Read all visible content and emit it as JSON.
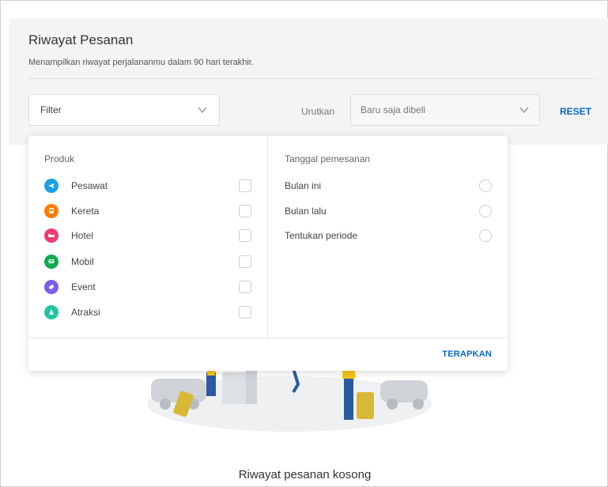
{
  "header": {
    "title": "Riwayat Pesanan",
    "subtitle": "Menampilkan riwayat perjalananmu dalam 90 hari terakhir."
  },
  "toolbar": {
    "filter_label": "Filter",
    "sort_label": "Urutkan",
    "sort_value": "Baru saja dibeli",
    "reset_label": "RESET"
  },
  "filter_panel": {
    "products_title": "Produk",
    "products": [
      {
        "label": "Pesawat",
        "icon": "plane-icon",
        "color": "#1ba0e2"
      },
      {
        "label": "Kereta",
        "icon": "train-icon",
        "color": "#ff7a00"
      },
      {
        "label": "Hotel",
        "icon": "bed-icon",
        "color": "#f03a73"
      },
      {
        "label": "Mobil",
        "icon": "car-icon",
        "color": "#13a94f"
      },
      {
        "label": "Event",
        "icon": "ticket-icon",
        "color": "#7a5cf0"
      },
      {
        "label": "Atraksi",
        "icon": "attraction-icon",
        "color": "#21c4a0"
      }
    ],
    "date_title": "Tanggal pemesanan",
    "dates": [
      {
        "label": "Bulan ini"
      },
      {
        "label": "Bulan lalu"
      },
      {
        "label": "Tentukan periode"
      }
    ],
    "apply_label": "TERAPKAN"
  },
  "empty_state": {
    "text": "Riwayat pesanan kosong"
  },
  "colors": {
    "accent": "#0b67c2"
  }
}
